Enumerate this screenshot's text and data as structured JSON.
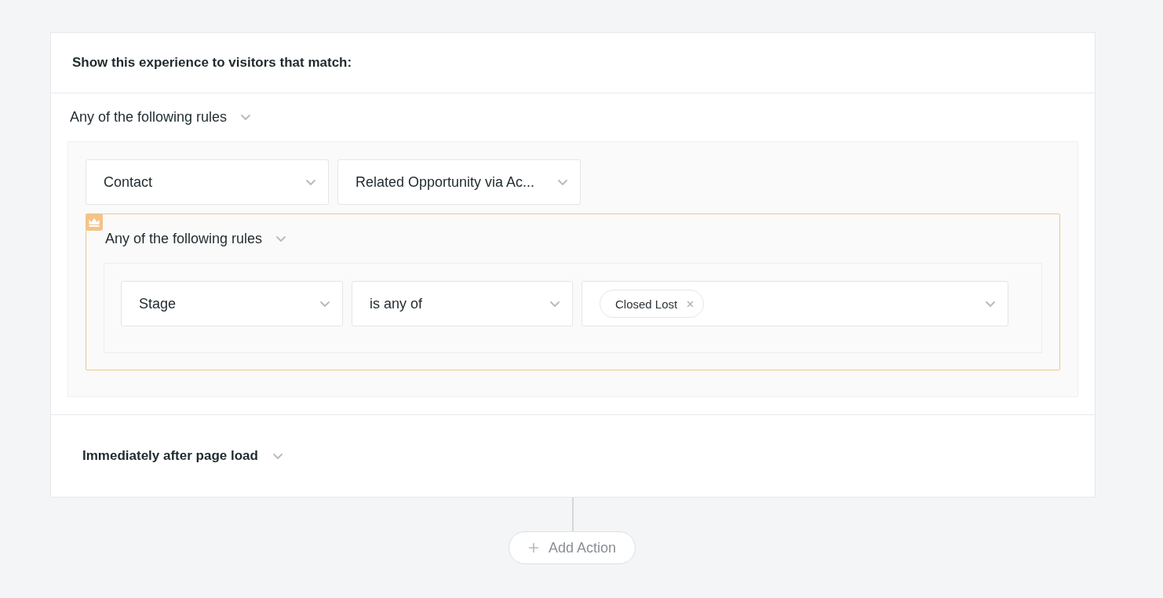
{
  "heading": "Show this experience to visitors that match:",
  "rule_group": {
    "match_label": "Any of the following rules",
    "fields": [
      {
        "value": "Contact"
      },
      {
        "value": "Related Opportunity via Ac..."
      }
    ],
    "nested_group": {
      "premium": true,
      "match_label": "Any of the following rules",
      "conditions": [
        {
          "field": "Stage",
          "operator": "is any of",
          "values": [
            {
              "label": "Closed Lost"
            }
          ]
        }
      ]
    }
  },
  "trigger": {
    "label": "Immediately after page load"
  },
  "add_action": {
    "label": "Add Action"
  }
}
